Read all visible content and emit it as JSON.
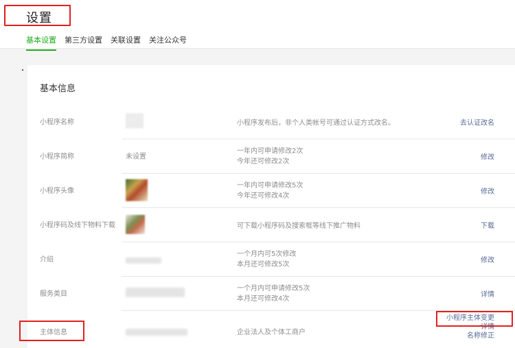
{
  "header": {
    "title": "设置",
    "tabs": [
      {
        "label": "基本设置",
        "active": true
      },
      {
        "label": "第三方设置",
        "active": false
      },
      {
        "label": "关联设置",
        "active": false
      },
      {
        "label": "关注公众号",
        "active": false
      }
    ]
  },
  "section": {
    "title": "基本信息",
    "rows": [
      {
        "label": "小程序名称",
        "value": "",
        "desc_line1": "小程序发布后，非个人类帐号可通过认证方式改名。",
        "desc_line2": "",
        "action1": "去认证改名"
      },
      {
        "label": "小程序简称",
        "value": "未设置",
        "desc_line1": "一年内可申请修改2次",
        "desc_line2": "今年还可修改2次",
        "action1": "修改"
      },
      {
        "label": "小程序头像",
        "value": "",
        "desc_line1": "一年内可申请修改5次",
        "desc_line2": "今年还可修改4次",
        "action1": "修改"
      },
      {
        "label": "小程序码及线下物料下载",
        "value": "",
        "desc_line1": "可下载小程序码及搜索框等线下推广物料",
        "desc_line2": "",
        "action1": "下载"
      },
      {
        "label": "介绍",
        "value": "",
        "desc_line1": "一个月内可5次修改",
        "desc_line2": "本月还可修改5次",
        "action1": "修改"
      },
      {
        "label": "服务类目",
        "value": "",
        "desc_line1": "一个月内可申请修改5次",
        "desc_line2": "本月还可修改4次",
        "action1": "详情"
      },
      {
        "label": "主体信息",
        "value": "",
        "desc_line1": "企业法人及个体工商户",
        "desc_line2": "",
        "action1": "小程序主体变更",
        "action2": "详情",
        "action3": "名称修正"
      }
    ]
  },
  "colors": {
    "accent": "#1aad19",
    "link": "#576b95",
    "highlight": "#e0201e"
  }
}
